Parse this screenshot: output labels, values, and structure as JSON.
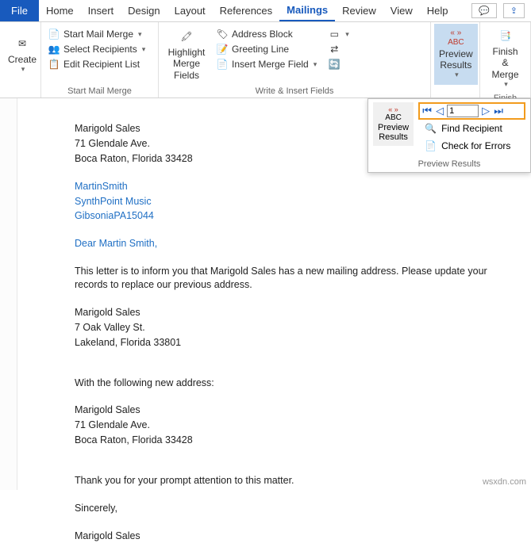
{
  "tabs": {
    "file": "File",
    "items": [
      "Home",
      "Insert",
      "Design",
      "Layout",
      "References",
      "Mailings",
      "Review",
      "View",
      "Help"
    ],
    "active": 5
  },
  "ribbon": {
    "create": {
      "label": "Create"
    },
    "startMerge": {
      "groupLabel": "Start Mail Merge",
      "startMailMerge": "Start Mail Merge",
      "selectRecipients": "Select Recipients",
      "editRecipientList": "Edit Recipient List"
    },
    "write": {
      "groupLabel": "Write & Insert Fields",
      "highlightMergeFields": "Highlight\nMerge Fields",
      "addressBlock": "Address Block",
      "greetingLine": "Greeting Line",
      "insertMergeField": "Insert Merge Field"
    },
    "preview": {
      "label": "Preview\nResults"
    },
    "finish": {
      "groupLabel": "Finish",
      "label": "Finish &\nMerge"
    }
  },
  "dropdown": {
    "previewResults": "Preview\nResults",
    "recordNumber": "1",
    "findRecipient": "Find Recipient",
    "checkErrors": "Check for Errors",
    "footer": "Preview Results"
  },
  "document": {
    "senderName": "Marigold Sales",
    "senderAddr1": "71 Glendale Ave.",
    "senderAddr2": "Boca Raton, Florida 33428",
    "recipFirstLast": "MartinSmith",
    "recipCompany": "SynthPoint Music",
    "recipCityZip": "GibsoniaPA15044",
    "salutation": "Dear Martin Smith,",
    "bodyIntro": "This letter is to inform you that Marigold Sales has a new mailing address. Please update your records to replace our previous address.",
    "oldName": "Marigold Sales",
    "oldAddr1": "7 Oak Valley St.",
    "oldAddr2": "Lakeland, Florida 33801",
    "transition": "With the following new address:",
    "newName": "Marigold Sales",
    "newAddr1": "71 Glendale Ave.",
    "newAddr2": "Boca Raton, Florida 33428",
    "thanks": "Thank you for your prompt attention to this matter.",
    "closing": "Sincerely,",
    "signature": "Marigold Sales"
  },
  "watermark": "wsxdn.com"
}
